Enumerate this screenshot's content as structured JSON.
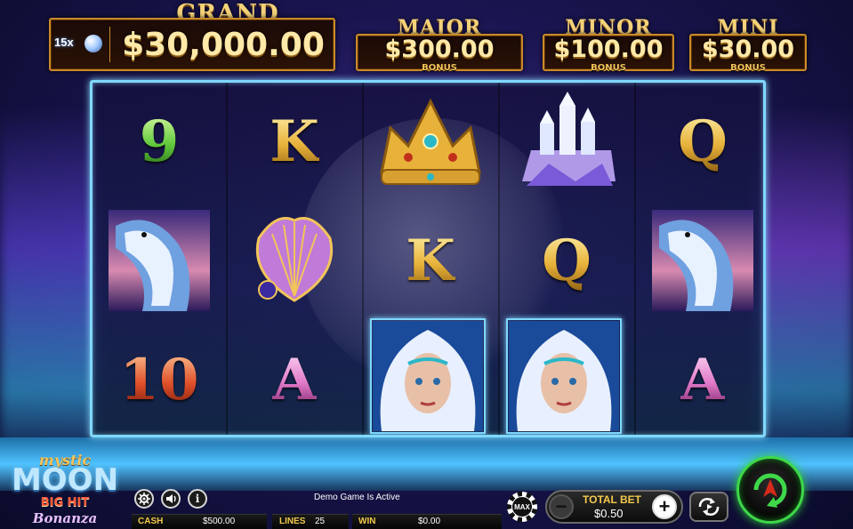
{
  "jackpots": {
    "grand": {
      "title": "GRAND",
      "value": "$30,000.00",
      "multiplier": "15x"
    },
    "major": {
      "title": "MAJOR",
      "value": "$300.00",
      "sub": "BONUS"
    },
    "minor": {
      "title": "MINOR",
      "value": "$100.00",
      "sub": "BONUS"
    },
    "mini": {
      "title": "MINI",
      "value": "$30.00",
      "sub": "BONUS"
    }
  },
  "reels": [
    [
      "9",
      "dolphin",
      "10"
    ],
    [
      "K",
      "seashell",
      "A"
    ],
    [
      "crown",
      "K",
      "moon-goddess"
    ],
    [
      "ice-castle",
      "Q",
      "moon-goddess"
    ],
    [
      "Q",
      "dolphin",
      "A"
    ]
  ],
  "symbols": {
    "r0_0": "9",
    "r0_2": "10",
    "r1_0": "K",
    "r1_2": "A",
    "r2_1": "K",
    "r3_1": "Q",
    "r4_0": "Q",
    "r4_2": "A"
  },
  "logo": {
    "line1": "mystic",
    "line2": "MOON",
    "line3": "BIG HIT",
    "line4": "Bonanza"
  },
  "status": "Demo Game Is Active",
  "meters": {
    "cash_label": "CASH",
    "cash_value": "$500.00",
    "lines_label": "LINES",
    "lines_value": "25",
    "win_label": "WIN",
    "win_value": "$0.00"
  },
  "bet": {
    "label": "TOTAL BET",
    "value": "$0.50",
    "max_label": "MAX",
    "minus": "−",
    "plus": "+"
  },
  "icons": {
    "settings": "gear-icon",
    "sound": "speaker-icon",
    "info": "info-icon",
    "auto": "autoplay-icon",
    "spin": "spin-arrow-icon",
    "moon": "moon-orb-icon"
  },
  "colors": {
    "accent_gold": "#f4d27a",
    "frame_cyan": "#7fd8ff",
    "spin_green": "#3fd84a"
  }
}
